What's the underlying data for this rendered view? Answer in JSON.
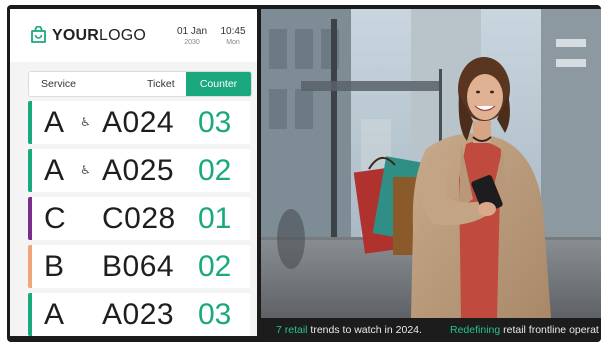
{
  "header": {
    "logo_bold": "YOUR",
    "logo_light": "LOGO",
    "date": "01 Jan",
    "year": "2030",
    "time": "10:45",
    "weekday": "Mon"
  },
  "tabs": {
    "service": "Service",
    "ticket": "Ticket",
    "counter": "Counter"
  },
  "colors": {
    "accent": "#1aa87f",
    "group_a": "#1aa87f",
    "group_c": "#7b2d8b",
    "group_b": "#f0a57a"
  },
  "queue": [
    {
      "service": "A",
      "accessibility": "wheelchair-icon",
      "ticket": "A024",
      "counter": "03"
    },
    {
      "service": "A",
      "accessibility": "wheelchair-icon",
      "ticket": "A025",
      "counter": "02"
    },
    {
      "service": "C",
      "ticket": "C028",
      "counter": "01"
    },
    {
      "service": "B",
      "ticket": "B064",
      "counter": "02"
    },
    {
      "service": "A",
      "ticket": "A023",
      "counter": "03"
    }
  ],
  "ticker": [
    {
      "highlight": "7 retail",
      "text": " trends to watch in 2024."
    },
    {
      "highlight": "Redefining",
      "text": " retail frontline operat"
    }
  ]
}
